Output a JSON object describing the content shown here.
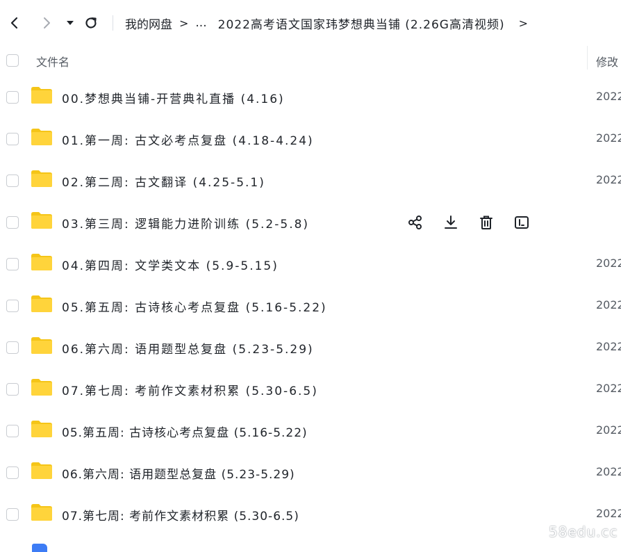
{
  "nav": {
    "back_icon": "chevron-left-icon",
    "forward_icon": "chevron-right-icon",
    "dropdown_icon": "caret-down-icon",
    "refresh_icon": "refresh-icon"
  },
  "breadcrumb": {
    "root": "我的网盘",
    "separator": ">",
    "ellipsis": "...",
    "current": "2022高考语文国家玮梦想典当铺 (2.26G高清视频)",
    "trailing_separator": ">"
  },
  "list_header": {
    "name_label": "文件名",
    "modified_label": "修改"
  },
  "rows": [
    {
      "name": "00.梦想典当铺-开营典礼直播 (4.16)",
      "date": "2022",
      "hover": false
    },
    {
      "name": "01.第一周: 古文必考点复盘 (4.18-4.24)",
      "date": "2022",
      "hover": false
    },
    {
      "name": "02.第二周: 古文翻译 (4.25-5.1)",
      "date": "2022",
      "hover": false
    },
    {
      "name": "03.第三周: 逻辑能力进阶训练 (5.2-5.8)",
      "date": "",
      "hover": true
    },
    {
      "name": "04.第四周: 文学类文本 (5.9-5.15)",
      "date": "2022",
      "hover": false
    },
    {
      "name": "05.第五周: 古诗核心考点复盘 (5.16-5.22)",
      "date": "2022",
      "hover": false
    },
    {
      "name": "06.第六周: 语用题型总复盘 (5.23-5.29)",
      "date": "2022",
      "hover": false
    },
    {
      "name": "07.第七周: 考前作文素材积累 (5.30-6.5)",
      "date": "2022",
      "hover": false
    },
    {
      "name": "05.第五周: 古诗核心考点复盘 (5.16-5.22)",
      "date": "2022",
      "hover": false
    },
    {
      "name": "06.第六周: 语用题型总复盘 (5.23-5.29)",
      "date": "2022",
      "hover": false
    },
    {
      "name": "07.第七周: 考前作文素材积累 (5.30-6.5)",
      "date": "2022",
      "hover": false
    }
  ],
  "row_actions": [
    "share-icon",
    "download-icon",
    "delete-icon",
    "rename-icon"
  ],
  "watermark": "58edu.cc",
  "colors": {
    "folder": "#FFD43B",
    "folder_dark": "#F5C518",
    "accent": "#3d7cf5"
  }
}
